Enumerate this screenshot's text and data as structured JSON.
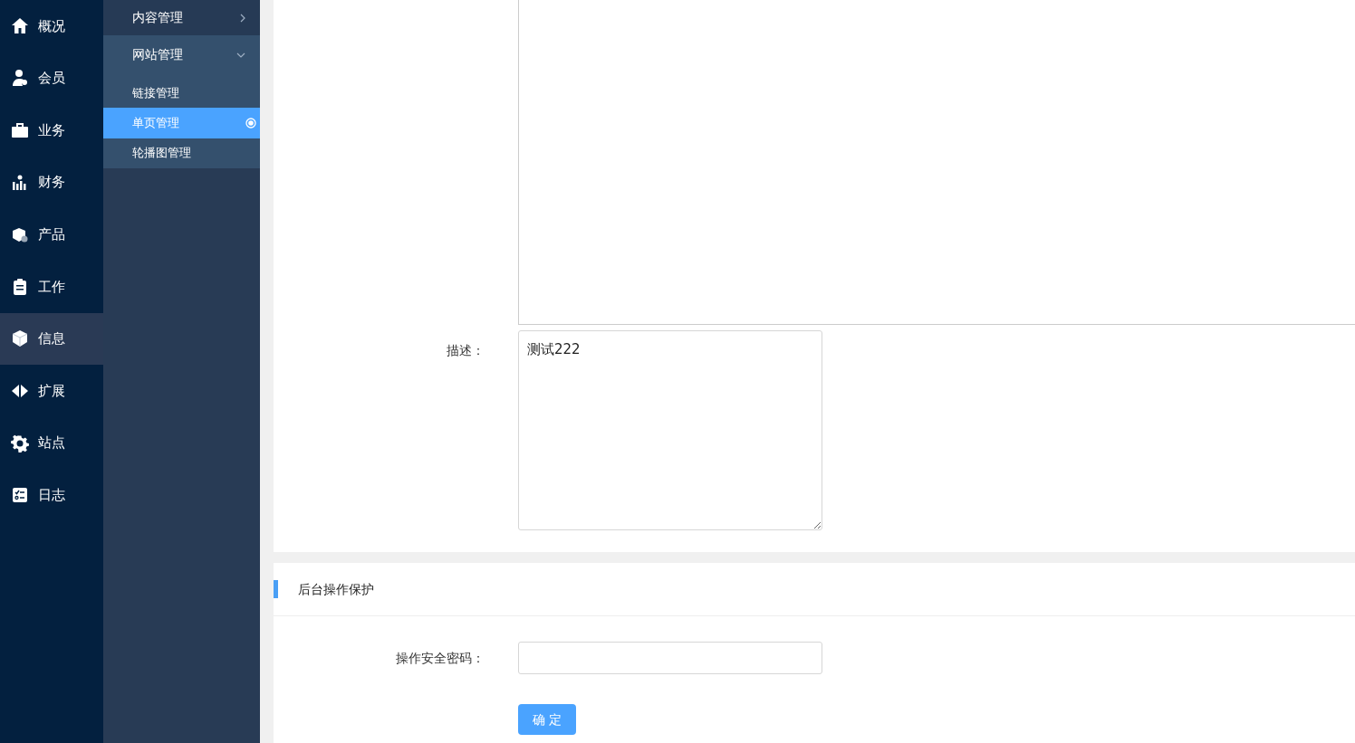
{
  "main_nav": [
    {
      "label": "概况",
      "selected": false
    },
    {
      "label": "会员",
      "selected": false
    },
    {
      "label": "业务",
      "selected": false
    },
    {
      "label": "财务",
      "selected": false
    },
    {
      "label": "产品",
      "selected": false
    },
    {
      "label": "工作",
      "selected": false
    },
    {
      "label": "信息",
      "selected": true
    },
    {
      "label": "扩展",
      "selected": false
    },
    {
      "label": "站点",
      "selected": false
    },
    {
      "label": "日志",
      "selected": false
    }
  ],
  "sub_nav": [
    {
      "label": "内容管理",
      "expanded": false
    },
    {
      "label": "网站管理",
      "expanded": true,
      "children": [
        {
          "label": "链接管理",
          "selected": false
        },
        {
          "label": "单页管理",
          "selected": true
        },
        {
          "label": "轮播图管理",
          "selected": false
        }
      ]
    }
  ],
  "form": {
    "description": {
      "label": "描述：",
      "value": "测试222"
    }
  },
  "protection": {
    "title": "后台操作保护",
    "password": {
      "label": "操作安全密码："
    },
    "submit": "确 定"
  }
}
